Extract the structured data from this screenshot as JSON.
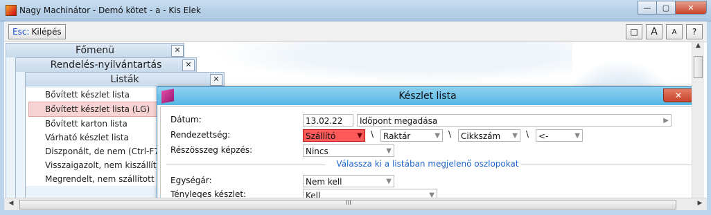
{
  "window": {
    "title": "Nagy Machinátor - Demó kötet - a - Kis Elek",
    "btn_min": "—",
    "btn_max": "▢",
    "btn_close": "✕"
  },
  "toolbar": {
    "esc_key": "Esc:",
    "esc_label": "Kilépés",
    "btn_layout": "□",
    "btn_font_big": "A",
    "btn_font_small": "A",
    "btn_help": "?"
  },
  "panels": {
    "fomenu": {
      "title": "Főmenü"
    },
    "rendeles": {
      "title": "Rendelés-nyilvántartás"
    },
    "listak": {
      "title": "Listák",
      "items": [
        "Bővített készlet lista",
        "Bővített készlet lista (LG)",
        "Bővített karton lista",
        "Várható készlet lista",
        "Diszponált, de nem (Ctrl-F7",
        "Visszaigazolt, nem kiszállító",
        "Megrendelt, nem szállított t"
      ],
      "selected_index": 1
    },
    "close_glyph": "✕"
  },
  "dialog": {
    "title": "Készlet lista",
    "close": "✕",
    "datum_label": "Dátum:",
    "datum_value": "13.02.22",
    "idopont_label": "Időpont megadása",
    "idopont_arrow": "▶",
    "rendezettseg_label": "Rendezettség:",
    "sort1": "Szállító",
    "sort2": "Raktár",
    "sort3": "Cikkszám",
    "sort4": "<-",
    "sep": "\\",
    "reszosszeg_label": "Részösszeg képzés:",
    "reszosszeg_value": "Nincs",
    "section_label": "Válassza ki a listában megjelenő oszlopokat",
    "egysegar_label": "Egységár:",
    "egysegar_value": "Nem kell",
    "tenyleges_label": "Tényleges készlet:",
    "tenyleges_value": "Kell"
  },
  "scroll": {
    "h_grip": "III",
    "left": "◀",
    "right": "▶",
    "up": "▲"
  }
}
